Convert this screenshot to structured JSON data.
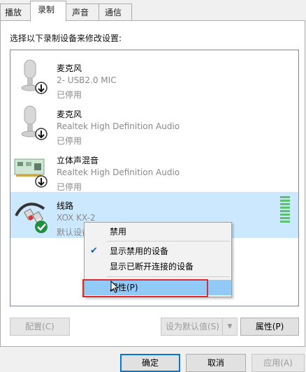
{
  "tabs": [
    {
      "label": "播放"
    },
    {
      "label": "录制"
    },
    {
      "label": "声音"
    },
    {
      "label": "通信"
    }
  ],
  "instruction": "选择以下录制设备来修改设置:",
  "devices": [
    {
      "name": "麦克风",
      "detail": "2- USB2.0 MIC",
      "status": "已停用",
      "icon": "microphone-icon"
    },
    {
      "name": "麦克风",
      "detail": "Realtek High Definition Audio",
      "status": "已停用",
      "icon": "microphone-icon"
    },
    {
      "name": "立体声混音",
      "detail": "Realtek High Definition Audio",
      "status": "已停用",
      "icon": "sound-card-icon"
    },
    {
      "name": "线路",
      "detail": "XOX KX-2",
      "status": "默认设备",
      "icon": "rca-cable-icon"
    }
  ],
  "context_menu": {
    "disable": "禁用",
    "show_disabled": "显示禁用的设备",
    "show_disconnected": "显示已断开连接的设备",
    "properties": "属性(P)"
  },
  "buttons": {
    "configure": "配置(C)",
    "set_default": "设为默认值(S)",
    "properties": "属性(P)",
    "ok": "确定",
    "cancel": "取消",
    "apply": "应用(A)"
  },
  "colors": {
    "selection": "#cce8ff",
    "menu_hover": "#91c9f7",
    "highlight_box": "#e5272d",
    "default_check": "#1e8f3c",
    "level_meter": "#5bc46b"
  }
}
